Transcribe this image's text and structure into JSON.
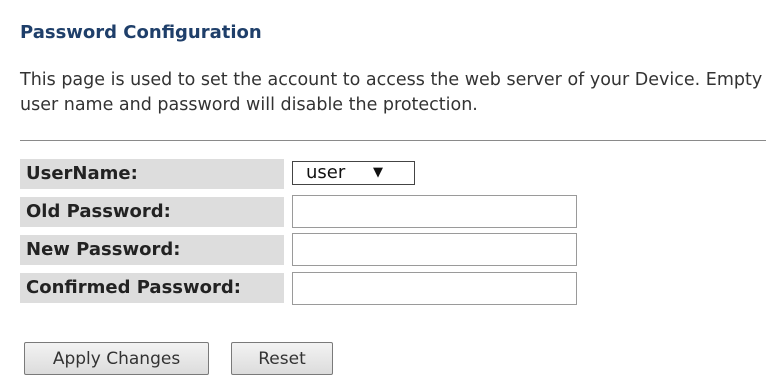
{
  "page": {
    "title": "Password Configuration",
    "description": "This page is used to set the account to access the web server of your Device. Empty user name and password will disable the protection."
  },
  "form": {
    "username_label": "UserName:",
    "username_value": "user",
    "old_password_label": "Old Password:",
    "new_password_label": "New Password:",
    "confirmed_password_label": "Confirmed Password:"
  },
  "buttons": {
    "apply_label": "Apply Changes",
    "reset_label": "Reset"
  },
  "icons": {
    "select_arrow": "dropdown-arrow"
  },
  "colors": {
    "title": "#1f3f6a",
    "label_background": "#dddddd"
  }
}
